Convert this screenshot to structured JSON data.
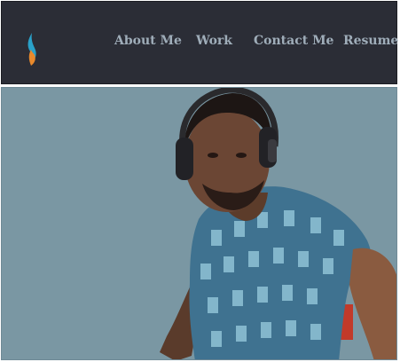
{
  "nav": {
    "logo_icon": "flame-logo-icon",
    "links": [
      {
        "label": "About Me"
      },
      {
        "label": "Work"
      },
      {
        "label": "Contact Me"
      },
      {
        "label": "Resume"
      }
    ]
  },
  "colors": {
    "navbar_bg": "#2b2d36",
    "nav_link": "#9fadb9",
    "hero_bg": "#7a97a3",
    "logo_blue": "#2aa1c9",
    "logo_orange": "#e8892c"
  },
  "hero": {
    "image": "portrait-photo"
  }
}
